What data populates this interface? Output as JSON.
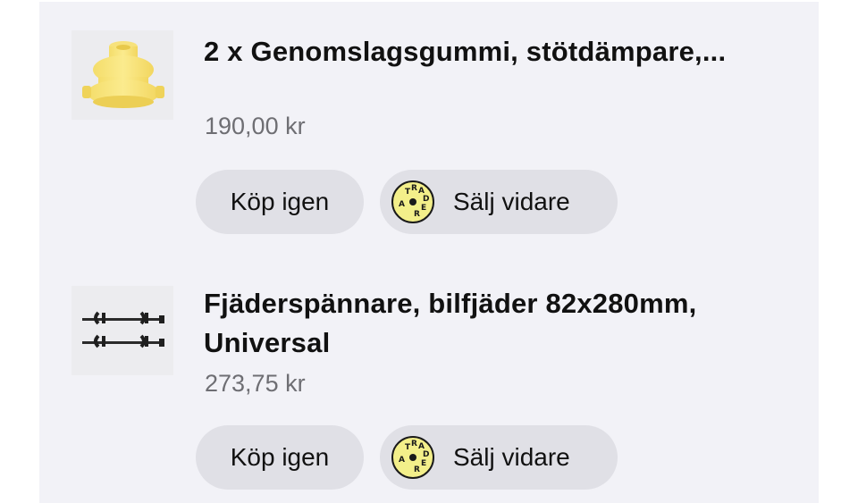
{
  "orders": [
    {
      "title": "2 x Genomslagsgummi, stötdämpare,...",
      "price": "190,00 kr",
      "buy_again_label": "Köp igen",
      "sell_label": "Sälj vidare",
      "thumbnail": "yellow-bump-stop-rubber"
    },
    {
      "title": "Fjäderspännare, bilfjäder 82x280mm, Universal",
      "price": "273,75 kr",
      "buy_again_label": "Köp igen",
      "sell_label": "Sälj vidare",
      "thumbnail": "spring-compressor-tool"
    }
  ],
  "tradera_logo_text": "TRADERA",
  "colors": {
    "background": "#f2f2f7",
    "button": "#e0e0e6",
    "price_text": "#6e6e73",
    "tradera_yellow": "#f3ef8a"
  }
}
